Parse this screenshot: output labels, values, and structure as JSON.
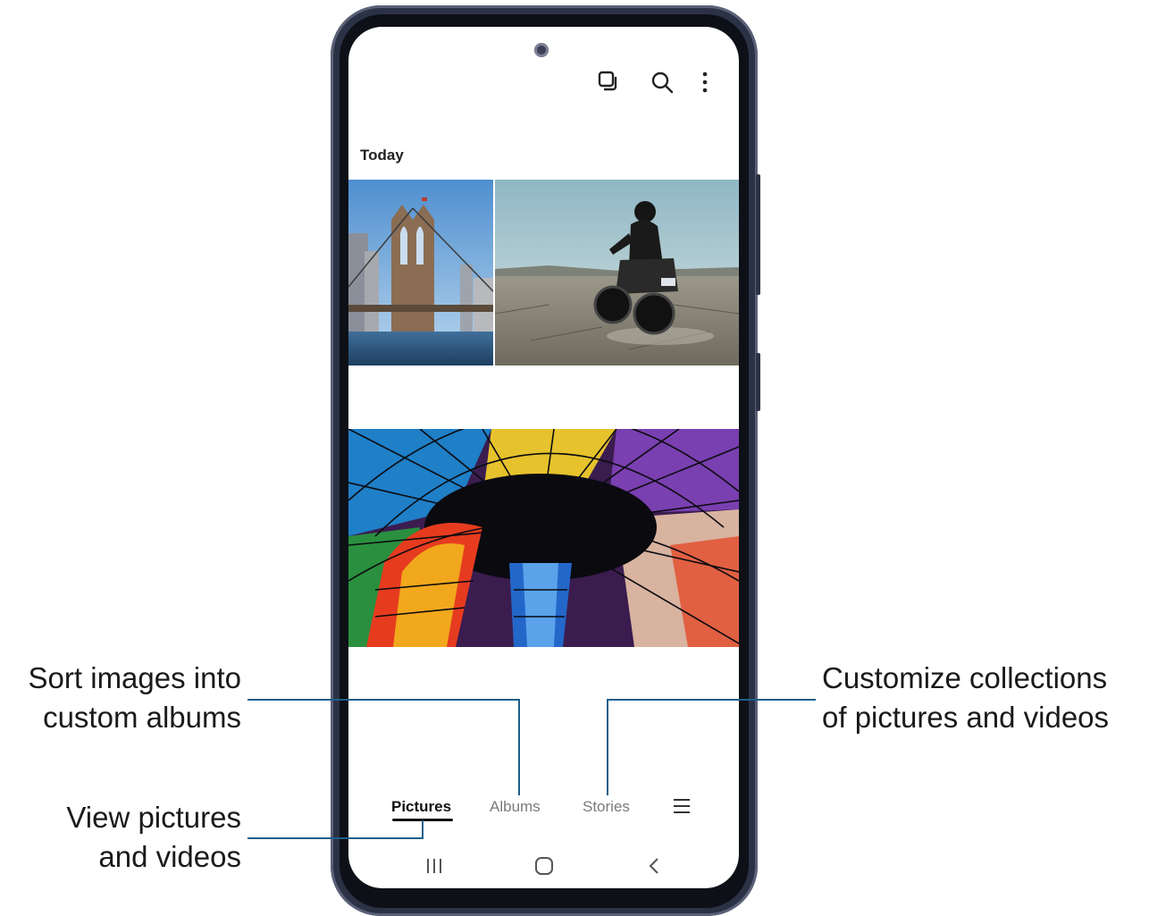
{
  "gallery": {
    "section_title": "Today",
    "top_icons": [
      "select-icon",
      "search-icon",
      "more-options-icon"
    ],
    "photos": [
      {
        "name": "photo-bridge",
        "subject": "bridge"
      },
      {
        "name": "photo-motorcycle",
        "subject": "motorcycle rider"
      },
      {
        "name": "photo-stained-glass-dome",
        "subject": "stained glass dome"
      }
    ]
  },
  "tabs": {
    "pictures": "Pictures",
    "albums": "Albums",
    "stories": "Stories",
    "selected": "Pictures",
    "menu_icon": "hamburger-menu-icon"
  },
  "nav_bar": {
    "icons": [
      "recent-apps-icon",
      "home-icon",
      "back-icon"
    ]
  },
  "callouts": {
    "sort": "Sort images into\ncustom albums",
    "view": "View pictures\nand videos",
    "customize": "Customize collections\nof pictures and videos"
  },
  "colors": {
    "frame": "#2c3246",
    "leader_line": "#1f5f8b",
    "tab_active": "#111111",
    "tab_inactive": "#7a7a7a"
  }
}
